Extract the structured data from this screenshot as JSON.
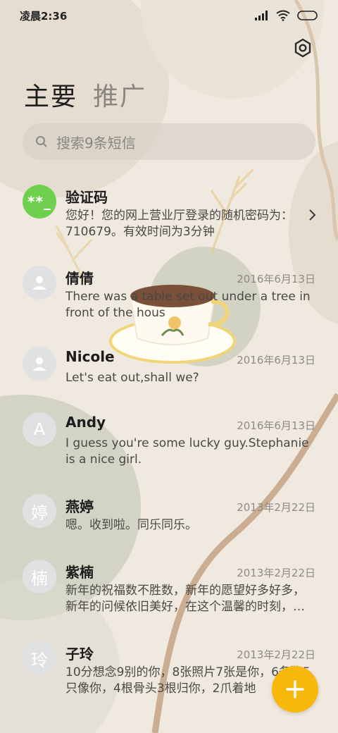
{
  "status_bar": {
    "time": "凌晨2:36"
  },
  "tabs": [
    {
      "label": "主要",
      "active": true
    },
    {
      "label": "推广",
      "active": false
    }
  ],
  "search": {
    "placeholder": "搜索9条短信"
  },
  "messages": [
    {
      "name": "验证码",
      "avatar_text": "**_",
      "avatar_style": "green",
      "date": "",
      "preview": "您好！您的网上营业厅登录的随机密码为：710679。有效时间为3分钟",
      "has_chevron": true
    },
    {
      "name": "倩倩",
      "avatar_text": "",
      "avatar_style": "person",
      "date": "2016年6月13日",
      "preview": "There was a table set out under a tree in front of the hous"
    },
    {
      "name": "Nicole",
      "avatar_text": "",
      "avatar_style": "person",
      "date": "2016年6月13日",
      "preview": "Let's eat out,shall we?"
    },
    {
      "name": "Andy",
      "avatar_text": "A",
      "avatar_style": "letter",
      "date": "2016年6月13日",
      "preview": "I guess you're some lucky guy.Stephanie is a nice girl."
    },
    {
      "name": "燕婷",
      "avatar_text": "婷",
      "avatar_style": "letter",
      "date": "2013年2月22日",
      "preview": "嗯。收到啦。同乐同乐。"
    },
    {
      "name": "紫楠",
      "avatar_text": "楠",
      "avatar_style": "letter",
      "date": "2013年2月22日",
      "preview": "新年的祝福数不胜数，新年的愿望好多好多，新年的问候依旧美好，在这个温馨的时刻，…"
    },
    {
      "name": "子玲",
      "avatar_text": "玲",
      "avatar_style": "letter",
      "date": "2013年2月22日",
      "preview": "10分想念9别的你，8张照片7张是你，6条狗5只像你，4根骨头3根归你，2爪着地"
    }
  ],
  "fab": {
    "icon": "plus-icon",
    "color": "#f7b70b"
  },
  "colors": {
    "background": "#efe9e0",
    "accent_green": "#6fcf4f",
    "fab_yellow": "#f7b70b"
  }
}
